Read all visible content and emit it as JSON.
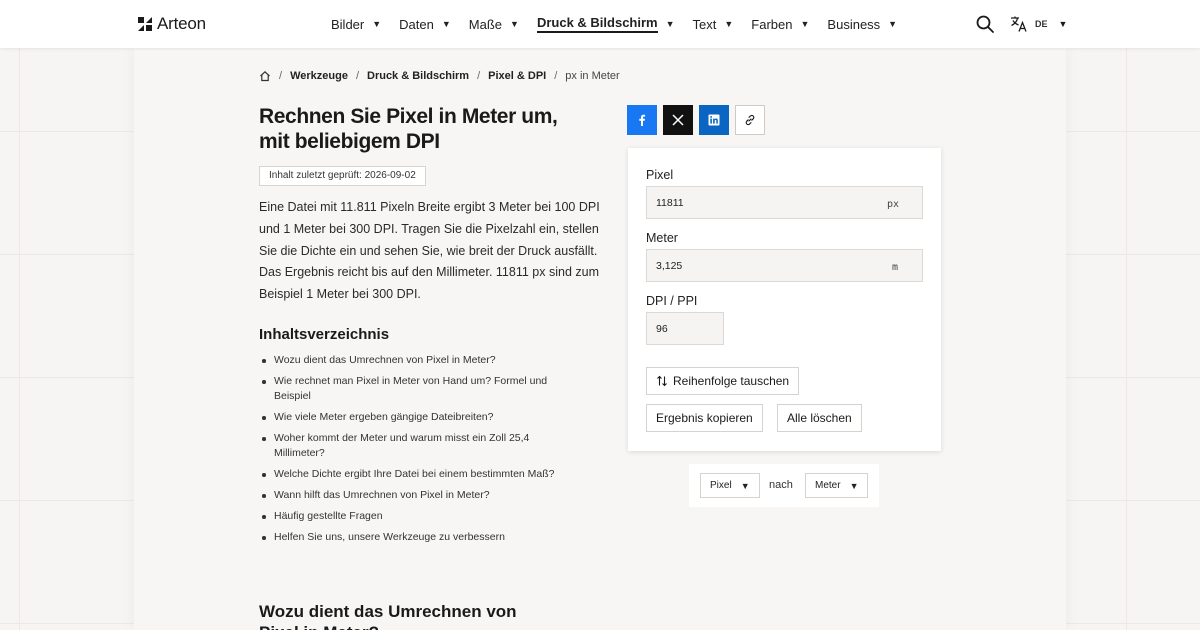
{
  "header": {
    "logo_text": "Arteon",
    "nav": [
      {
        "label": "Bilder",
        "active": false
      },
      {
        "label": "Daten",
        "active": false
      },
      {
        "label": "Maße",
        "active": false
      },
      {
        "label": "Druck & Bildschirm",
        "active": true
      },
      {
        "label": "Text",
        "active": false
      },
      {
        "label": "Farben",
        "active": false
      },
      {
        "label": "Business",
        "active": false
      }
    ],
    "language": "DE"
  },
  "breadcrumb": {
    "items": [
      "Werkzeuge",
      "Druck & Bildschirm",
      "Pixel & DPI"
    ],
    "current": "px in Meter"
  },
  "page": {
    "title": "Rechnen Sie Pixel in Meter um, mit beliebigem DPI",
    "reviewed": "Inhalt zuletzt geprüft: 2026-09-02",
    "intro": "Eine Datei mit 11.811 Pixeln Breite ergibt 3 Meter bei 100 DPI und 1 Meter bei 300 DPI. Tragen Sie die Pixelzahl ein, stellen Sie die Dichte ein und sehen Sie, wie breit der Druck ausfällt. Das Ergebnis reicht bis auf den Millimeter. 11811 px sind zum Beispiel 1 Meter bei 300 DPI."
  },
  "toc": {
    "title": "Inhaltsverzeichnis",
    "items": [
      "Wozu dient das Umrechnen von Pixel in Meter?",
      "Wie rechnet man Pixel in Meter von Hand um? Formel und Beispiel",
      "Wie viele Meter ergeben gängige Dateibreiten?",
      "Woher kommt der Meter und warum misst ein Zoll 25,4 Millimeter?",
      "Welche Dichte ergibt Ihre Datei bei einem bestimmten Maß?",
      "Wann hilft das Umrechnen von Pixel in Meter?",
      "Häufig gestellte Fragen",
      "Helfen Sie uns, unsere Werkzeuge zu verbessern"
    ]
  },
  "section": {
    "title": "Wozu dient das Umrechnen von Pixel in Meter?"
  },
  "converter": {
    "pixel": {
      "label": "Pixel",
      "value": "11811",
      "unit": "px"
    },
    "meter": {
      "label": "Meter",
      "value": "3,125",
      "unit": "m"
    },
    "dpi": {
      "label": "DPI / PPI",
      "value": "96"
    },
    "swap_label": "Reihenfolge tauschen",
    "copy_label": "Ergebnis kopieren",
    "clear_label": "Alle löschen"
  },
  "unit_switch": {
    "from": "Pixel",
    "connector": "nach",
    "to": "Meter"
  },
  "colors": {
    "facebook": "#1877f2",
    "x": "#111111",
    "linkedin": "#0a66c2"
  }
}
